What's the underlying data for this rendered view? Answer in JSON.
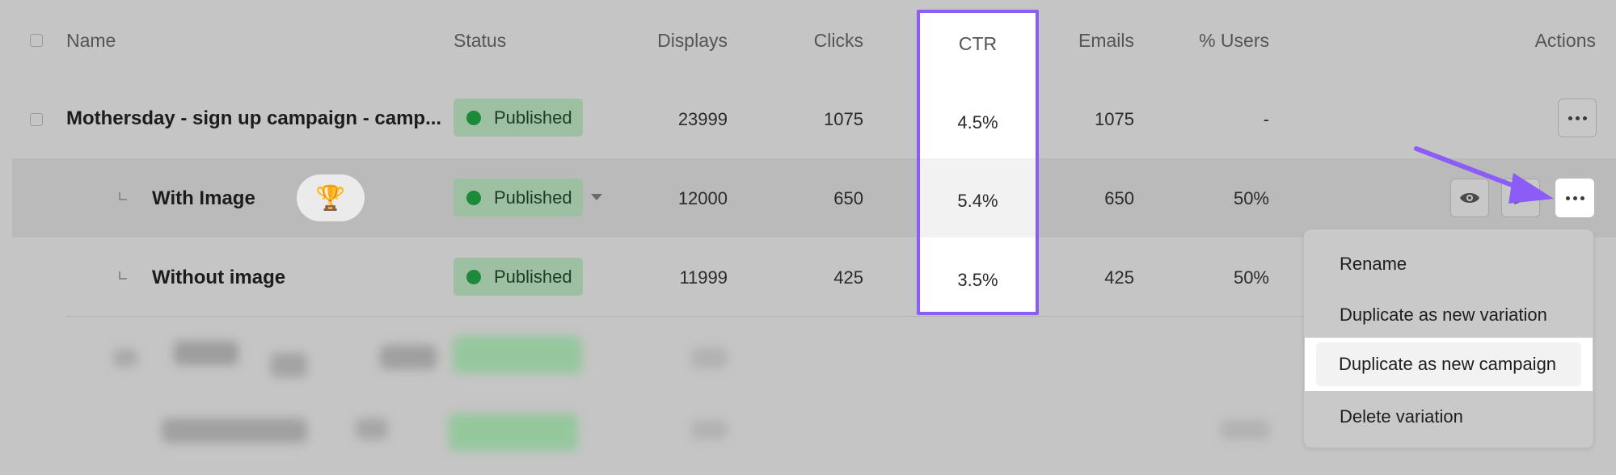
{
  "header": {
    "name": "Name",
    "status": "Status",
    "displays": "Displays",
    "clicks": "Clicks",
    "ctr": "CTR",
    "emails": "Emails",
    "users": "% Users",
    "actions": "Actions"
  },
  "rows": [
    {
      "name": "Mothersday - sign up campaign - camp...",
      "status": "Published",
      "displays": "23999",
      "clicks": "1075",
      "ctr": "4.5%",
      "emails": "1075",
      "users": "-"
    },
    {
      "name": "With Image",
      "badge": "🏆",
      "status": "Published",
      "displays": "12000",
      "clicks": "650",
      "ctr": "5.4%",
      "emails": "650",
      "users": "50%"
    },
    {
      "name": "Without image",
      "status": "Published",
      "displays": "11999",
      "clicks": "425",
      "ctr": "3.5%",
      "emails": "425",
      "users": "50%"
    }
  ],
  "menu": {
    "items": [
      "Rename",
      "Duplicate as new variation",
      "Duplicate as new campaign",
      "Delete variation"
    ]
  },
  "colors": {
    "accent": "#8b5cf6",
    "status_bg": "#9dc0a3",
    "status_dot": "#1d8a3a"
  }
}
